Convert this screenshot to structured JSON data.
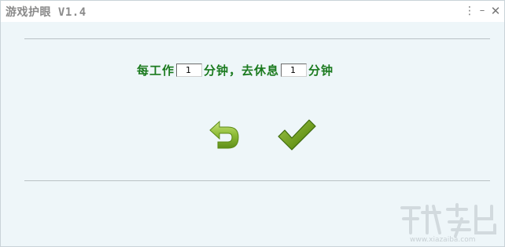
{
  "window": {
    "title": "游戏护眼 V1.4"
  },
  "title_buttons": {
    "menu_glyph": "⋮",
    "minimize_glyph": "–",
    "close_glyph": "✕"
  },
  "settings": {
    "work_prefix": "每工作",
    "work_minutes": "1",
    "work_suffix": "分钟，去休息",
    "rest_minutes": "1",
    "rest_suffix": "分钟"
  },
  "actions": {
    "back_icon": "undo-arrow-icon",
    "confirm_icon": "checkmark-icon"
  },
  "watermark": {
    "text": "www.xiazaiba.com"
  },
  "colors": {
    "label_green": "#1a7a1e",
    "icon_green": "#6a9a1c",
    "background": "#eef6f9"
  }
}
